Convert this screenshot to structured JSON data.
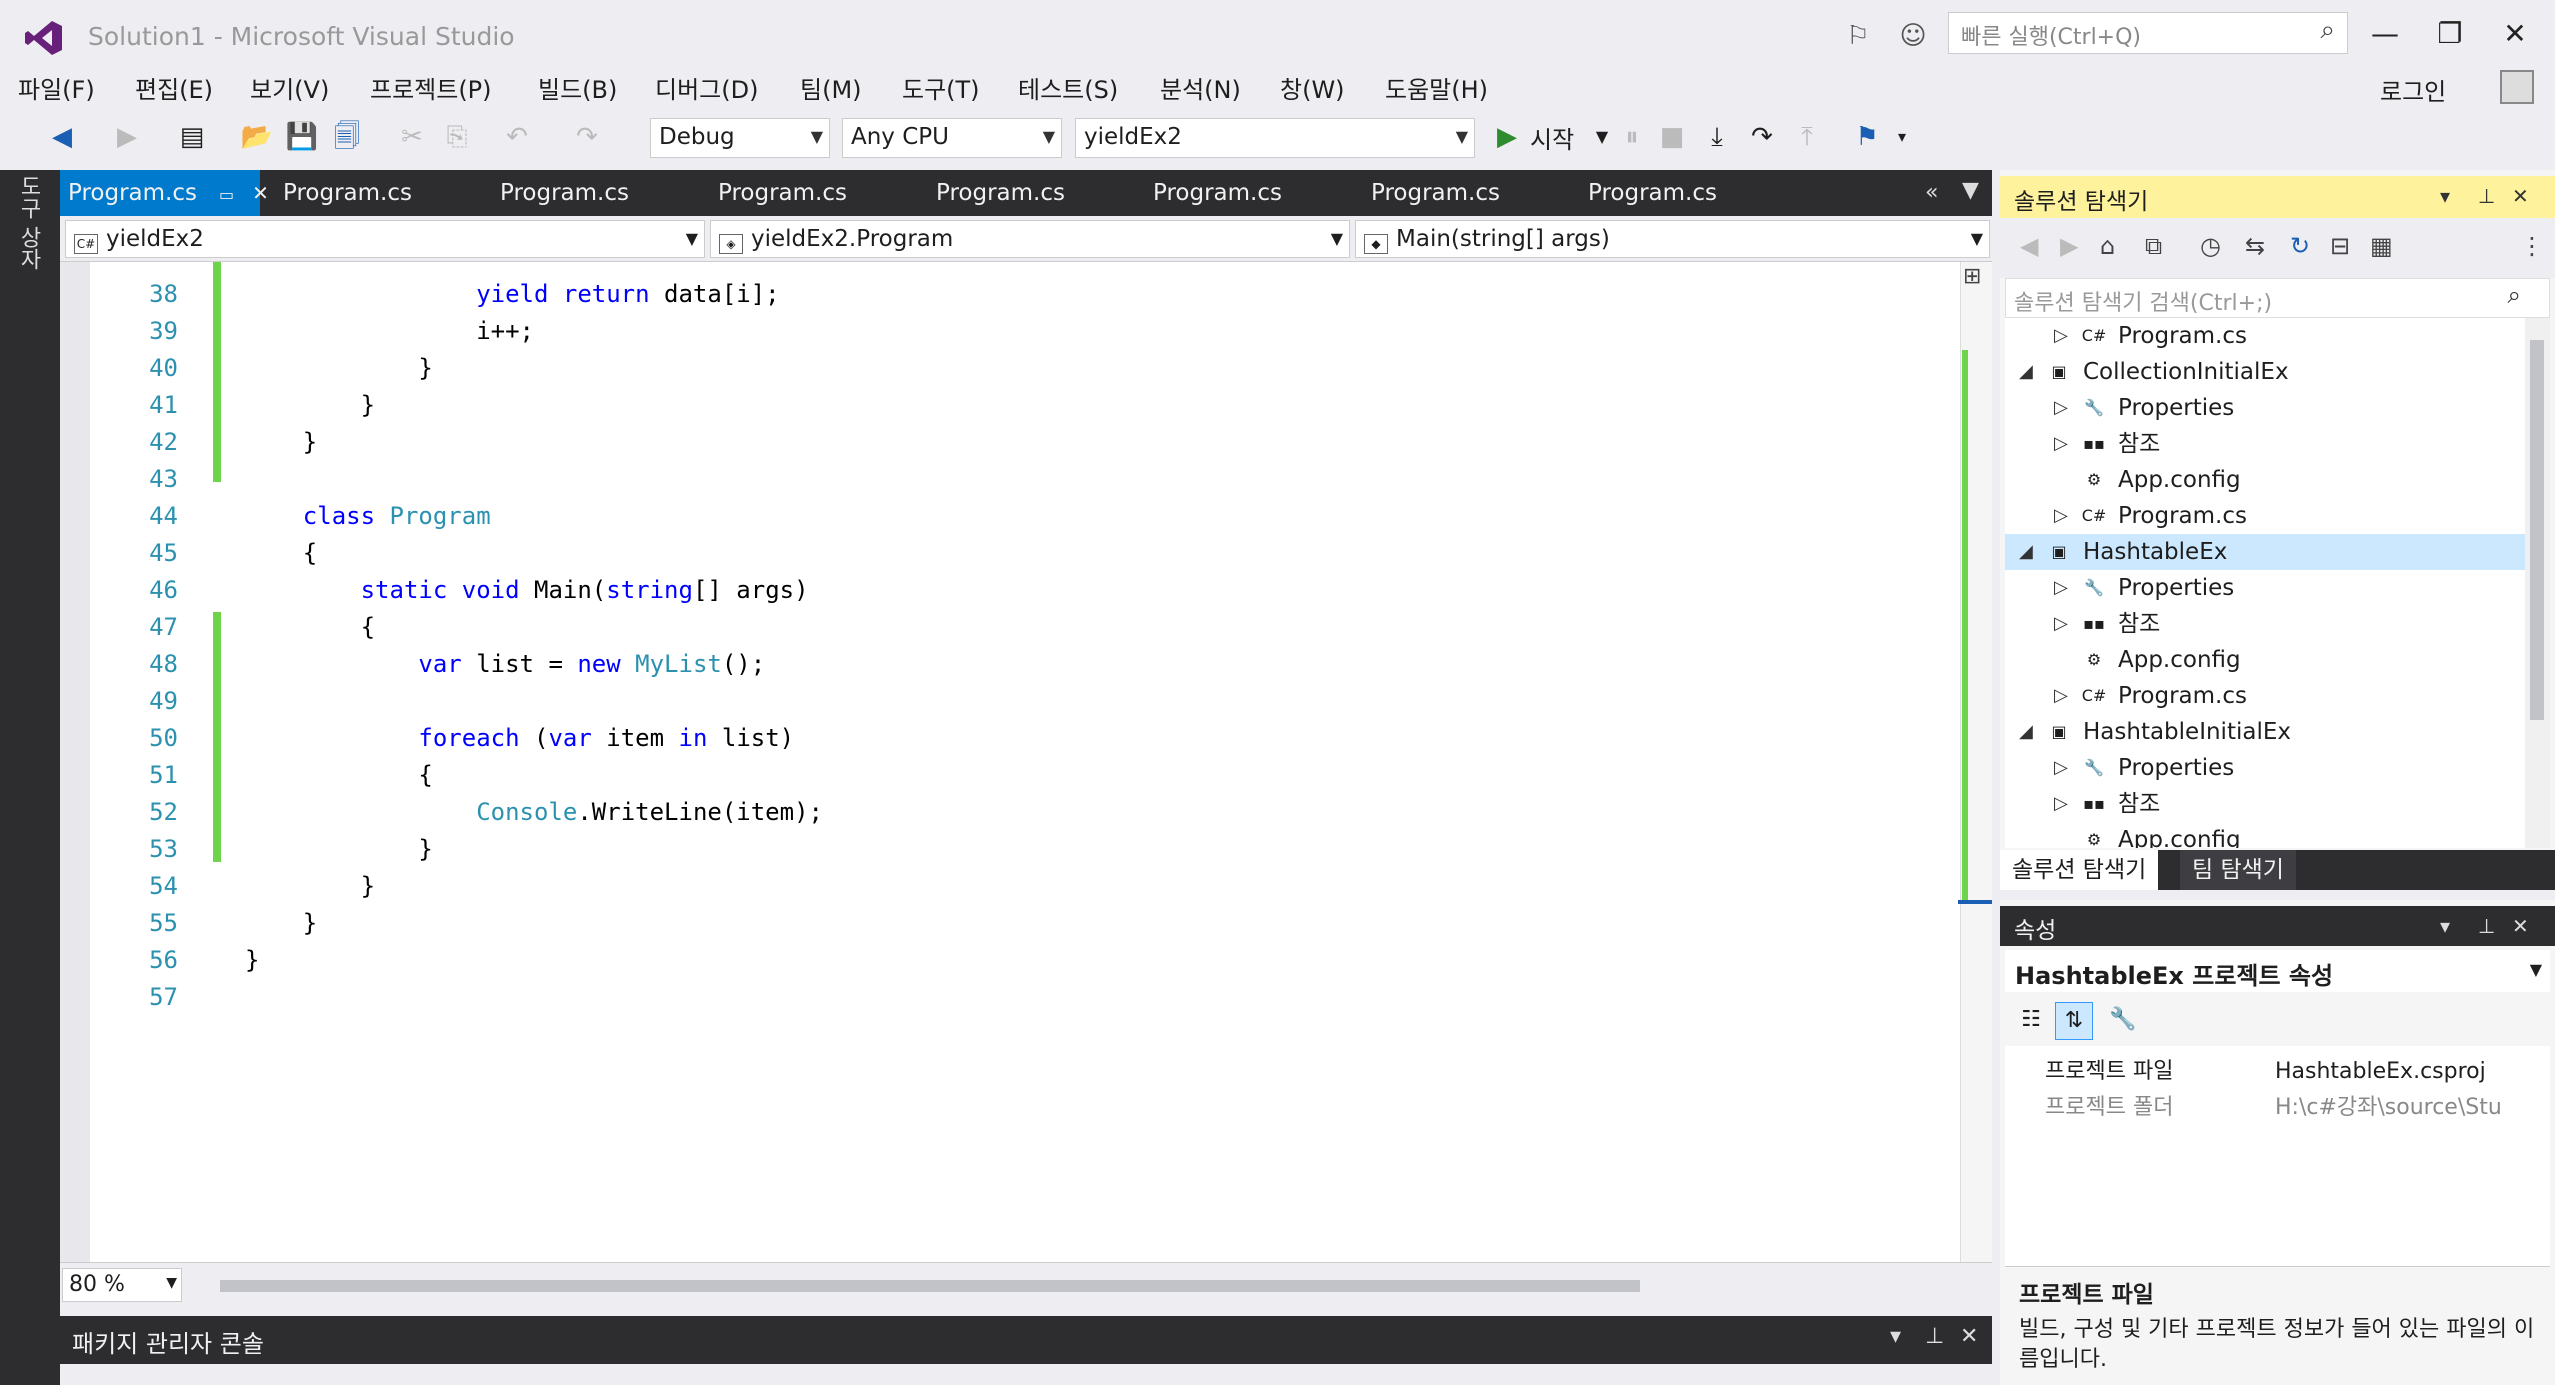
{
  "window": {
    "title": "Solution1 - Microsoft Visual Studio",
    "quick_launch_placeholder": "빠른 실행(Ctrl+Q)",
    "login_label": "로그인"
  },
  "menu": [
    "파일(F)",
    "편집(E)",
    "보기(V)",
    "프로젝트(P)",
    "빌드(B)",
    "디버그(D)",
    "팀(M)",
    "도구(T)",
    "테스트(S)",
    "분석(N)",
    "창(W)",
    "도움말(H)"
  ],
  "toolbar": {
    "config": "Debug",
    "platform": "Any CPU",
    "startup_project": "yieldEx2",
    "start_label": "시작"
  },
  "left_rail_tab": "도구 상자",
  "doc_tabs": [
    "Program.cs",
    "Program.cs",
    "Program.cs",
    "Program.cs",
    "Program.cs",
    "Program.cs",
    "Program.cs",
    "Program.cs"
  ],
  "navbar": {
    "project": "yieldEx2",
    "type": "yieldEx2.Program",
    "member": "Main(string[] args)"
  },
  "editor": {
    "zoom": "80 %",
    "lines": [
      {
        "num": "38",
        "html": "                <span class=\"kw\">yield return</span> data[i];"
      },
      {
        "num": "39",
        "html": "                i++;"
      },
      {
        "num": "40",
        "html": "            }"
      },
      {
        "num": "41",
        "html": "        }"
      },
      {
        "num": "42",
        "html": "    }"
      },
      {
        "num": "43",
        "html": ""
      },
      {
        "num": "44",
        "html": "    <span class=\"kw\">class</span> <span class=\"ty\">Program</span>"
      },
      {
        "num": "45",
        "html": "    {"
      },
      {
        "num": "46",
        "html": "        <span class=\"kw\">static void</span> Main(<span class=\"kw\">string</span>[] args)"
      },
      {
        "num": "47",
        "html": "        {"
      },
      {
        "num": "48",
        "html": "            <span class=\"kw\">var</span> list = <span class=\"kw\">new</span> <span class=\"ty\">MyList</span>();"
      },
      {
        "num": "49",
        "html": ""
      },
      {
        "num": "50",
        "html": "            <span class=\"kw\">foreach</span> (<span class=\"kw\">var</span> item <span class=\"kw\">in</span> list)"
      },
      {
        "num": "51",
        "html": "            {"
      },
      {
        "num": "52",
        "html": "                <span class=\"ty\">Console</span>.WriteLine(item);"
      },
      {
        "num": "53",
        "html": "            }"
      },
      {
        "num": "54",
        "html": "        }"
      },
      {
        "num": "55",
        "html": "    }"
      },
      {
        "num": "56",
        "html": "}"
      },
      {
        "num": "57",
        "html": ""
      }
    ]
  },
  "package_console": {
    "title": "패키지 관리자 콘솔"
  },
  "solution_explorer": {
    "title": "솔루션 탐색기",
    "search_placeholder": "솔루션 탐색기 검색(Ctrl+;)",
    "tree": [
      {
        "label": "Program.cs",
        "icon": "cs-file-icon",
        "depth": 2,
        "expander": "▷",
        "selected": false
      },
      {
        "label": "CollectionInitialEx",
        "icon": "cs-project-icon",
        "depth": 1,
        "expander": "◢",
        "selected": false
      },
      {
        "label": "Properties",
        "icon": "wrench-icon",
        "depth": 2,
        "expander": "▷",
        "selected": false
      },
      {
        "label": "참조",
        "icon": "references-icon",
        "depth": 2,
        "expander": "▷",
        "selected": false
      },
      {
        "label": "App.config",
        "icon": "config-file-icon",
        "depth": 2,
        "expander": "",
        "selected": false
      },
      {
        "label": "Program.cs",
        "icon": "cs-file-icon",
        "depth": 2,
        "expander": "▷",
        "selected": false
      },
      {
        "label": "HashtableEx",
        "icon": "cs-project-icon",
        "depth": 1,
        "expander": "◢",
        "selected": true
      },
      {
        "label": "Properties",
        "icon": "wrench-icon",
        "depth": 2,
        "expander": "▷",
        "selected": false
      },
      {
        "label": "참조",
        "icon": "references-icon",
        "depth": 2,
        "expander": "▷",
        "selected": false
      },
      {
        "label": "App.config",
        "icon": "config-file-icon",
        "depth": 2,
        "expander": "",
        "selected": false
      },
      {
        "label": "Program.cs",
        "icon": "cs-file-icon",
        "depth": 2,
        "expander": "▷",
        "selected": false
      },
      {
        "label": "HashtableInitialEx",
        "icon": "cs-project-icon",
        "depth": 1,
        "expander": "◢",
        "selected": false
      },
      {
        "label": "Properties",
        "icon": "wrench-icon",
        "depth": 2,
        "expander": "▷",
        "selected": false
      },
      {
        "label": "참조",
        "icon": "references-icon",
        "depth": 2,
        "expander": "▷",
        "selected": false
      },
      {
        "label": "App.config",
        "icon": "config-file-icon",
        "depth": 2,
        "expander": "",
        "selected": false
      }
    ],
    "tabs": [
      "솔루션 탐색기",
      "팀 탐색기"
    ]
  },
  "properties": {
    "title": "속성",
    "object": "HashtableEx 프로젝트 속성",
    "rows": [
      {
        "name": "프로젝트 파일",
        "value": "HashtableEx.csproj"
      },
      {
        "name": "프로젝트 폴더",
        "value": "H:\\c#강좌\\source\\Stu"
      }
    ],
    "desc_title": "프로젝트 파일",
    "desc_text": "빌드, 구성 및 기타 프로젝트 정보가 들어 있는 파일의 이름입니다."
  }
}
